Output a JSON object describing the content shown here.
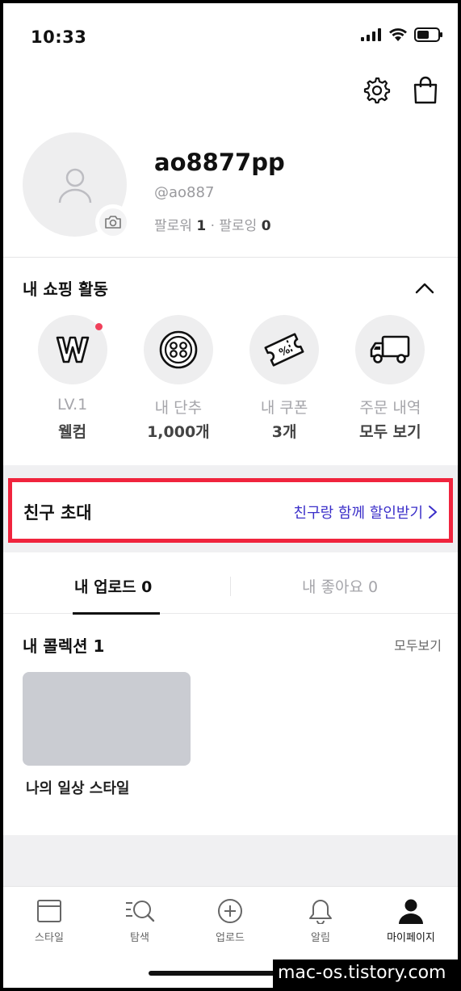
{
  "status_bar": {
    "time": "10:33"
  },
  "profile": {
    "username": "ao8877pp",
    "handle": "@ao887",
    "followers_label": "팔로워",
    "followers_count": "1",
    "separator": "·",
    "following_label": "팔로잉",
    "following_count": "0"
  },
  "shopping": {
    "title": "내 쇼핑 활동",
    "items": [
      {
        "icon": "w-badge-icon",
        "label": "LV.1",
        "value": "웰컴"
      },
      {
        "icon": "button-coin-icon",
        "label": "내 단추",
        "value": "1,000개"
      },
      {
        "icon": "coupon-icon",
        "label": "내 쿠폰",
        "value": "3개"
      },
      {
        "icon": "truck-icon",
        "label": "주문 내역",
        "value": "모두 보기"
      }
    ]
  },
  "invite": {
    "title": "친구 초대",
    "link": "친구랑 함께 할인받기"
  },
  "tabs": {
    "upload": "내 업로드 0",
    "likes": "내 좋아요 0"
  },
  "collections": {
    "title": "내 콜렉션 1",
    "see_all": "모두보기",
    "items": [
      {
        "name": "나의 일상 스타일"
      }
    ]
  },
  "bottom_nav": [
    {
      "label": "스타일",
      "icon": "style-icon"
    },
    {
      "label": "탐색",
      "icon": "search-icon"
    },
    {
      "label": "업로드",
      "icon": "upload-plus-icon"
    },
    {
      "label": "알림",
      "icon": "bell-icon"
    },
    {
      "label": "마이페이지",
      "icon": "person-icon"
    }
  ],
  "watermark": "mac-os.tistory.com",
  "colors": {
    "accent_red": "#f0243d",
    "link_purple": "#3b2fc9",
    "notification_dot": "#f0405a"
  }
}
